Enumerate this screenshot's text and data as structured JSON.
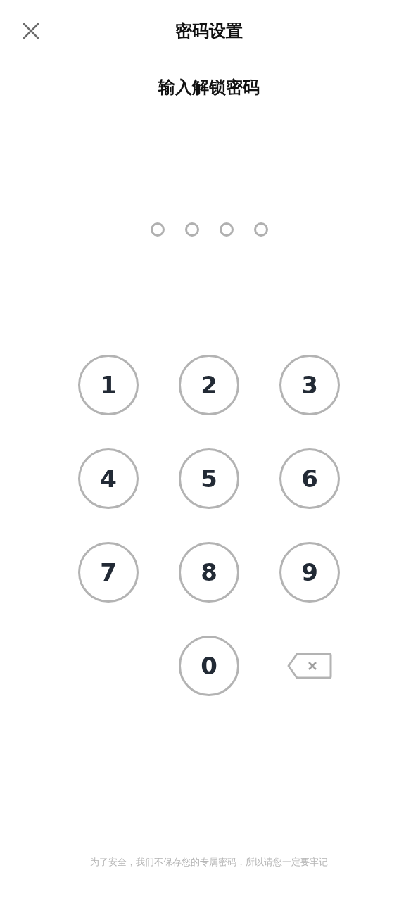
{
  "title": "密码设置",
  "prompt": "输入解锁密码",
  "pin_dots": [
    {
      "filled": false
    },
    {
      "filled": false
    },
    {
      "filled": false
    },
    {
      "filled": false
    }
  ],
  "keys": [
    {
      "kind": "digit",
      "label": "1"
    },
    {
      "kind": "digit",
      "label": "2"
    },
    {
      "kind": "digit",
      "label": "3"
    },
    {
      "kind": "digit",
      "label": "4"
    },
    {
      "kind": "digit",
      "label": "5"
    },
    {
      "kind": "digit",
      "label": "6"
    },
    {
      "kind": "digit",
      "label": "7"
    },
    {
      "kind": "digit",
      "label": "8"
    },
    {
      "kind": "digit",
      "label": "9"
    },
    {
      "kind": "blank"
    },
    {
      "kind": "digit",
      "label": "0"
    },
    {
      "kind": "backspace"
    }
  ],
  "footer": "为了安全，我们不保存您的专属密码，所以请您一定要牢记"
}
